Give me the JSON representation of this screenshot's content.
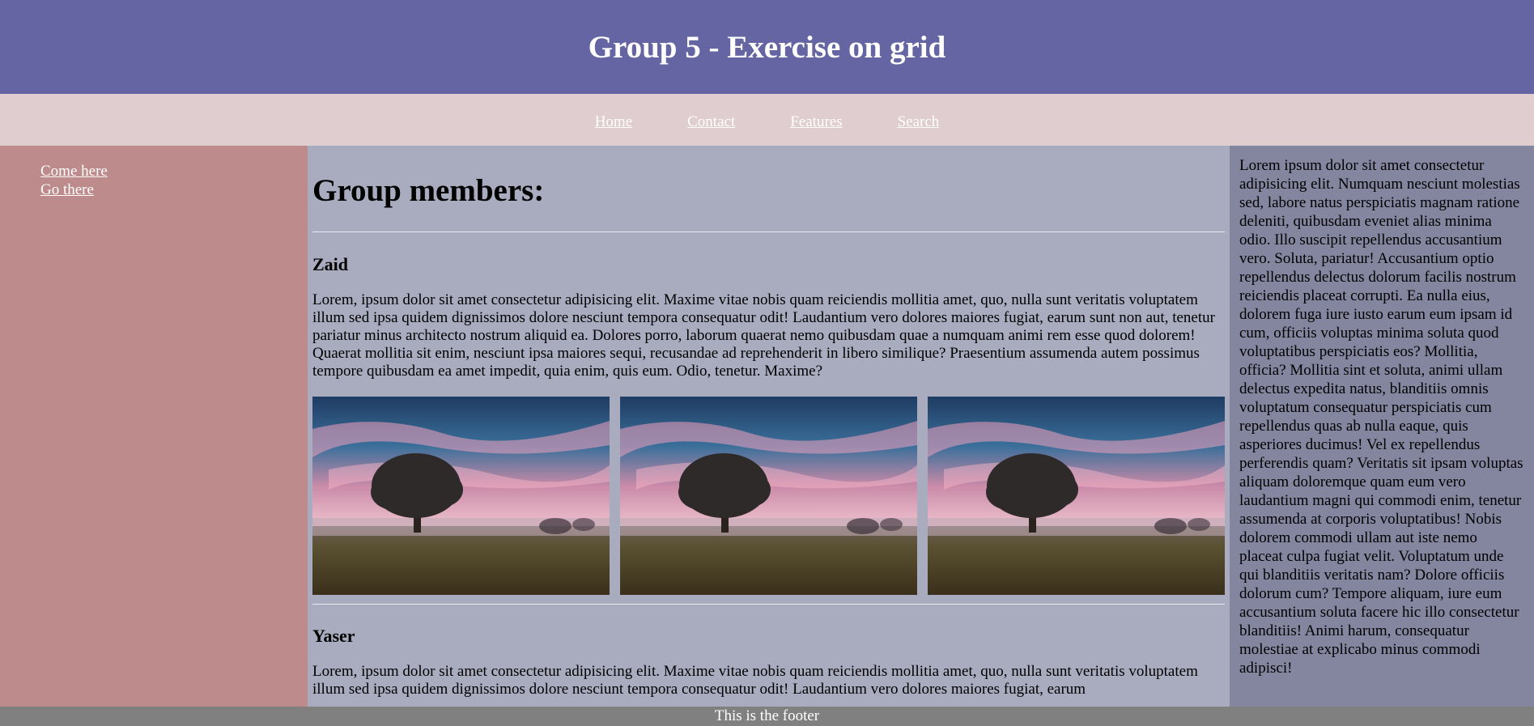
{
  "header": {
    "title": "Group 5 - Exercise on grid"
  },
  "nav": {
    "items": [
      {
        "label": "Home"
      },
      {
        "label": "Contact"
      },
      {
        "label": "Features"
      },
      {
        "label": "Search"
      }
    ]
  },
  "sidebar_left": {
    "links": [
      {
        "label": "Come here"
      },
      {
        "label": "Go there"
      }
    ]
  },
  "main": {
    "title": "Group members:",
    "members": [
      {
        "name": "Zaid",
        "text": "Lorem, ipsum dolor sit amet consectetur adipisicing elit. Maxime vitae nobis quam reiciendis mollitia amet, quo, nulla sunt veritatis voluptatem illum sed ipsa quidem dignissimos dolore nesciunt tempora consequatur odit! Laudantium vero dolores maiores fugiat, earum sunt non aut, tenetur pariatur minus architecto nostrum aliquid ea. Dolores porro, laborum quaerat nemo quibusdam quae a numquam animi rem esse quod dolorem! Quaerat mollitia sit enim, nesciunt ipsa maiores sequi, recusandae ad reprehenderit in libero similique? Praesentium assumenda autem possimus tempore quibusdam ea amet impedit, quia enim, quis eum. Odio, tenetur. Maxime?"
      },
      {
        "name": "Yaser",
        "text": "Lorem, ipsum dolor sit amet consectetur adipisicing elit. Maxime vitae nobis quam reiciendis mollitia amet, quo, nulla sunt veritatis voluptatem illum sed ipsa quidem dignissimos dolore nesciunt tempora consequatur odit! Laudantium vero dolores maiores fugiat, earum"
      }
    ],
    "gallery": [
      {
        "image": "tree-landscape-photo"
      },
      {
        "image": "tree-landscape-photo"
      },
      {
        "image": "tree-landscape-photo"
      }
    ]
  },
  "sidebar_right": {
    "text": "Lorem ipsum dolor sit amet consectetur adipisicing elit. Numquam nesciunt molestias sed, labore natus perspiciatis magnam ratione deleniti, quibusdam eveniet alias minima odio. Illo suscipit repellendus accusantium vero. Soluta, pariatur! Accusantium optio repellendus delectus dolorum facilis nostrum reiciendis placeat corrupti. Ea nulla eius, dolorem fuga iure iusto earum eum ipsam id cum, officiis voluptas minima soluta quod voluptatibus perspiciatis eos? Mollitia, officia? Mollitia sint et soluta, animi ullam delectus expedita natus, blanditiis omnis voluptatum consequatur perspiciatis cum repellendus quas ab nulla eaque, quis asperiores ducimus! Vel ex repellendus perferendis quam? Veritatis sit ipsam voluptas aliquam doloremque quam eum vero laudantium magni qui commodi enim, tenetur assumenda at corporis voluptatibus! Nobis dolorem commodi ullam aut iste nemo placeat culpa fugiat velit. Voluptatum unde qui blanditiis veritatis nam? Dolore officiis dolorum cum? Tempore aliquam, iure eum accusantium soluta facere hic illo consectetur blanditiis! Animi harum, consequatur molestiae at explicabo minus commodi adipisci!"
  },
  "footer": {
    "text": "This is the footer"
  },
  "colors": {
    "header_bg": "#6565a3",
    "nav_bg": "#e0cdd0",
    "left_bg": "#bd8b8b",
    "main_bg": "#a9abbf",
    "right_bg": "#84859f",
    "footer_bg": "#808080"
  }
}
